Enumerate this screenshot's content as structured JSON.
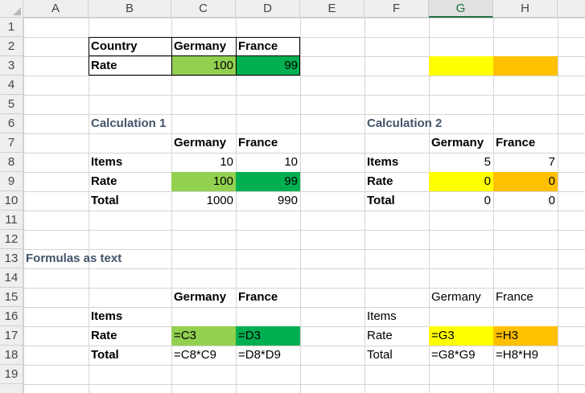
{
  "grid": {
    "columns": [
      "A",
      "B",
      "C",
      "D",
      "E",
      "F",
      "G",
      "H"
    ],
    "selected_column": "G",
    "rows": [
      "1",
      "2",
      "3",
      "4",
      "5",
      "6",
      "7",
      "8",
      "9",
      "10",
      "11",
      "12",
      "13",
      "14",
      "15",
      "16",
      "17",
      "18",
      "19"
    ]
  },
  "colors": {
    "light_green": "#92d050",
    "green": "#00b050",
    "yellow": "#ffff00",
    "orange": "#ffc000",
    "section_title": "#44546a"
  },
  "table_top": {
    "country_label": "Country",
    "rate_label": "Rate",
    "germany": "Germany",
    "france": "France",
    "germany_rate": "100",
    "france_rate": "99"
  },
  "calc1": {
    "title": "Calculation 1",
    "germany": "Germany",
    "france": "France",
    "items_label": "Items",
    "rate_label": "Rate",
    "total_label": "Total",
    "items": [
      "10",
      "10"
    ],
    "rate": [
      "100",
      "99"
    ],
    "total": [
      "1000",
      "990"
    ]
  },
  "calc2": {
    "title": "Calculation 2",
    "germany": "Germany",
    "france": "France",
    "items_label": "Items",
    "rate_label": "Rate",
    "total_label": "Total",
    "items": [
      "5",
      "7"
    ],
    "rate": [
      "0",
      "0"
    ],
    "total": [
      "0",
      "0"
    ]
  },
  "formulas": {
    "title": "Formulas as text",
    "left": {
      "germany": "Germany",
      "france": "France",
      "items_label": "Items",
      "rate_label": "Rate",
      "total_label": "Total",
      "rate": [
        "=C3",
        "=D3"
      ],
      "total": [
        "=C8*C9",
        "=D8*D9"
      ]
    },
    "right": {
      "germany": "Germany",
      "france": "France",
      "items_label": "Items",
      "rate_label": "Rate",
      "total_label": "Total",
      "rate": [
        "=G3",
        "=H3"
      ],
      "total": [
        "=G8*G9",
        "=H8*H9"
      ]
    }
  }
}
